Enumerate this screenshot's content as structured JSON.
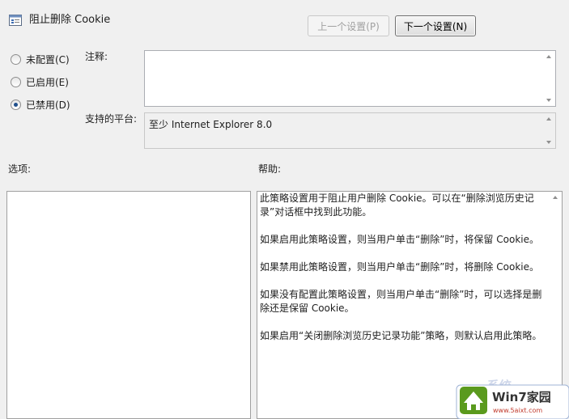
{
  "header": {
    "title": "阻止删除 Cookie",
    "prev_button": "上一个设置(P)",
    "next_button": "下一个设置(N)"
  },
  "state": {
    "options": [
      {
        "label": "未配置(C)",
        "checked": false
      },
      {
        "label": "已启用(E)",
        "checked": false
      },
      {
        "label": "已禁用(D)",
        "checked": true
      }
    ]
  },
  "comment": {
    "label": "注释:",
    "value": ""
  },
  "platform": {
    "label": "支持的平台:",
    "value": "至少 Internet Explorer 8.0"
  },
  "options_section": {
    "label": "选项:"
  },
  "help_section": {
    "label": "帮助:",
    "paragraphs": [
      "此策略设置用于阻止用户删除 Cookie。可以在“删除浏览历史记录”对话框中找到此功能。",
      "如果启用此策略设置，则当用户单击“删除”时，将保留 Cookie。",
      "如果禁用此策略设置，则当用户单击“删除”时，将删除 Cookie。",
      "如果没有配置此策略设置，则当用户单击“删除”时，可以选择是删除还是保留 Cookie。",
      "如果启用“关闭删除浏览历史记录功能”策略，则默认启用此策略。"
    ]
  },
  "watermark": {
    "brand": "Win7家园",
    "url": "www.5aixt.com",
    "partial_text": "系统"
  }
}
